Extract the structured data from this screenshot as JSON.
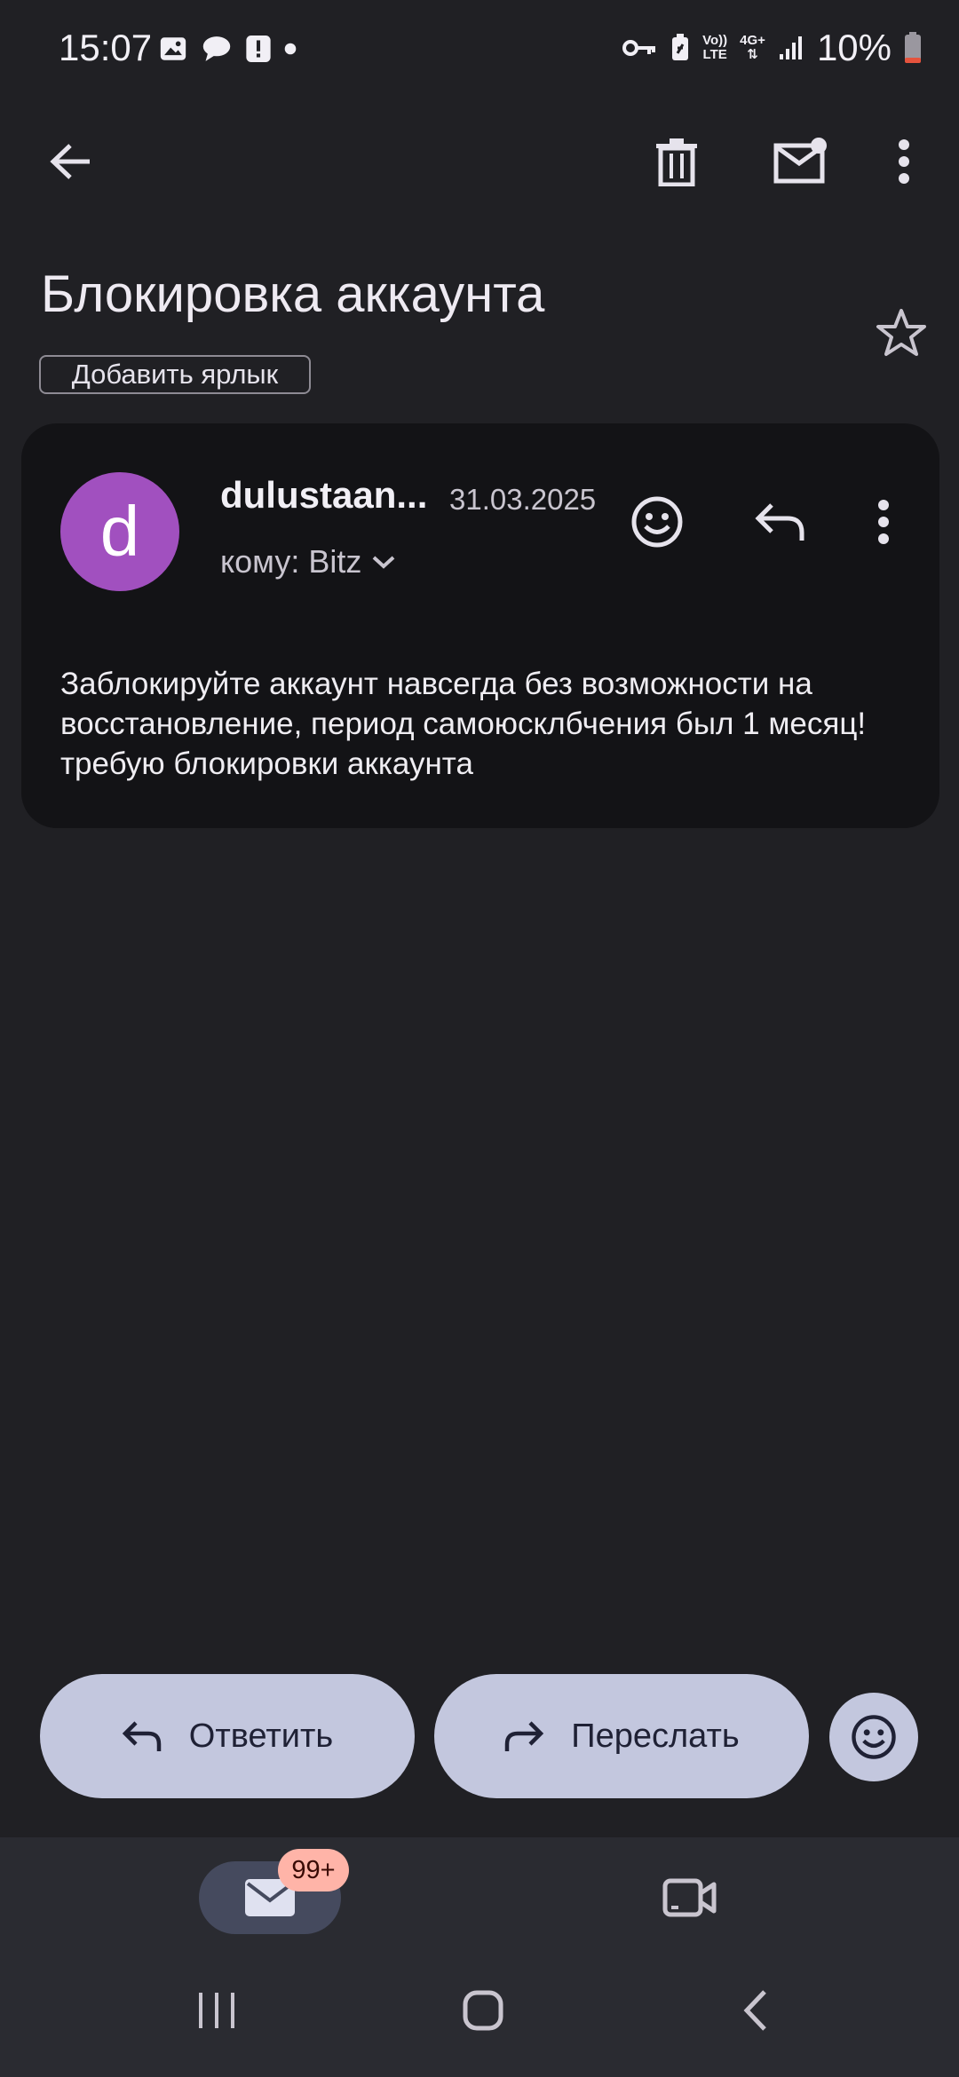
{
  "status_bar": {
    "time": "15:07",
    "battery_percent": "10%",
    "network_top": "Vo))",
    "network_bottom": "LTE",
    "signal_type": "4G+"
  },
  "toolbar": {
    "back_icon": "arrow-left-icon",
    "delete_icon": "trash-icon",
    "mark_unread_icon": "mail-unread-icon",
    "more_icon": "more-vert-icon"
  },
  "email": {
    "subject": "Блокировка аккаунта",
    "add_label": "Добавить ярлык",
    "avatar_letter": "d",
    "sender": "dulustaan...",
    "date": "31.03.2025",
    "to": "кому: Bitz",
    "body": "Заблокируйте аккаунт навсегда без возможности на восстановление, период самоюсклбчения был 1 месяц!требую блокировки аккаунта"
  },
  "actions": {
    "reply_label": "Ответить",
    "forward_label": "Переслать"
  },
  "bottom_nav": {
    "mail_badge": "99+"
  },
  "colors": {
    "background": "#202024",
    "card": "#131316",
    "avatar": "#a150bf",
    "pill": "#c3c7de",
    "badge": "#ffb4a8"
  }
}
